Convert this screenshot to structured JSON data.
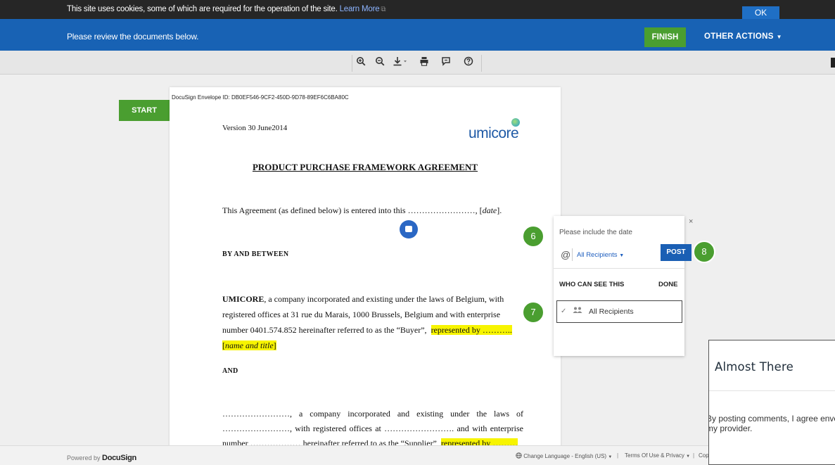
{
  "cookie_bar": {
    "text": "This site uses cookies, some of which are required for the operation of the site.",
    "link_label": "Learn More",
    "ok_label": "OK"
  },
  "header": {
    "message": "Please review the documents below.",
    "finish_label": "FINISH",
    "other_actions_label": "OTHER ACTIONS"
  },
  "toolbar": {
    "icons": [
      "zoom-in-icon",
      "zoom-out-icon",
      "download-icon",
      "print-icon",
      "comment-toggle-icon",
      "help-icon"
    ]
  },
  "start_label": "START",
  "document": {
    "envelope_id": "DocuSign Envelope ID: DB0EF546-9CF2-450D-9D78-89EF6C6BA80C",
    "version": "Version 30 June2014",
    "logo_text": "umicore",
    "title": "PRODUCT PURCHASE FRAMEWORK AGREEMENT",
    "para1_text": "This Agreement (as defined below) is entered into this ……………………, [",
    "para1_italic": "date",
    "para1_end": "].",
    "by_between": "BY AND BETWEEN",
    "umicore_bold": "UMICORE",
    "umicore_text": ", a company incorporated and existing under the laws of Belgium, with registered offices at 31 rue du Marais, 1000 Brussels, Belgium and with enterprise number 0401.574.852 hereinafter referred to as the “Buyer”,",
    "umicore_highlight": "represented by ……….. [",
    "umicore_highlight_italic": "name and title",
    "umicore_highlight_end": "]",
    "and_label": "AND",
    "supplier_text": "……………………, a company incorporated and existing under the laws of ……………………, with registered offices at ……………………. and with enterprise number ……………… hereinafter referred to as the “Supplier”,",
    "supplier_highlight": "represented by ………"
  },
  "comment_panel": {
    "text": "Please include the date",
    "close_label": "×",
    "at_symbol": "@",
    "recipients_label": "All Recipients",
    "post_label": "POST",
    "who_label": "WHO CAN SEE THIS",
    "done_label": "DONE",
    "check_mark": "✓",
    "row_label": "All Recipients"
  },
  "step_badges": [
    "6",
    "7",
    "8"
  ],
  "almost_there": {
    "title": "Almost There",
    "body": "By posting comments, I agree envelope recipients and my provider."
  },
  "footer": {
    "powered_by": "Powered by",
    "brand": "DocuSign",
    "language": "Change Language - English (US)",
    "separator": "|",
    "terms": "Terms Of Use & Privacy",
    "cut_text": "Copyright"
  }
}
